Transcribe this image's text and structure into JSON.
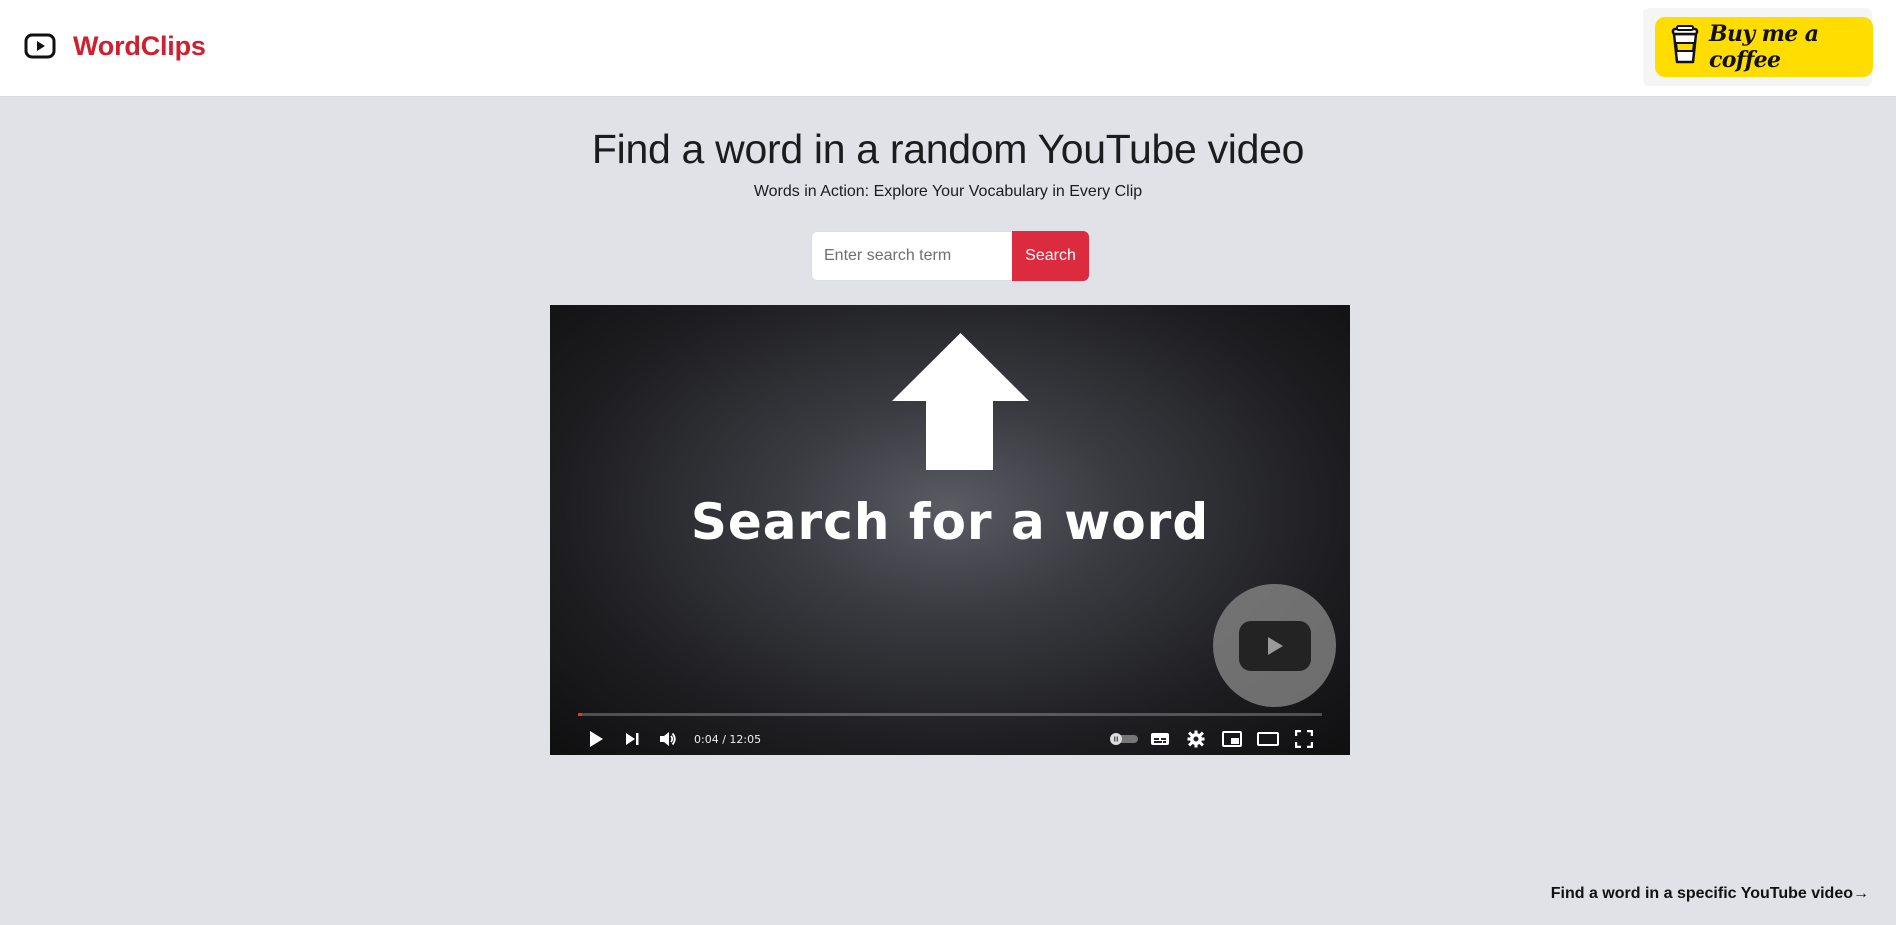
{
  "header": {
    "brand_name": "WordClips",
    "brand_icon": "youtube-play-icon",
    "brand_color": "#d0202f",
    "coffee_label": "Buy me a coffee",
    "coffee_icon": "coffee-cup-icon",
    "coffee_color": "#ffdd00"
  },
  "hero": {
    "title": "Find a word in a random YouTube video",
    "subtitle": "Words in Action: Explore Your Vocabulary in Every Clip"
  },
  "search": {
    "placeholder": "Enter search term",
    "value": "",
    "button_label": "Search",
    "button_color": "#dc2a3e"
  },
  "player": {
    "caption": "Search for a word",
    "time": "0:04 / 12:05",
    "progress_fraction": 0.0055,
    "controls": [
      "play-icon",
      "next-icon",
      "volume-icon",
      "autoplay-toggle",
      "subtitles-icon",
      "settings-icon",
      "miniplayer-icon",
      "theater-icon",
      "fullscreen-icon"
    ]
  },
  "footer": {
    "link_label": "Find a word in a specific YouTube video→"
  }
}
